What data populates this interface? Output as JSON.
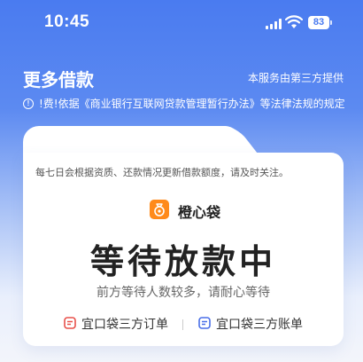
{
  "status_bar": {
    "time": "10:45",
    "battery": "83"
  },
  "header": {
    "title": "更多借款",
    "provider_note": "本服务由第三方提供",
    "notice": "!费!依据《商业银行互联网贷款管理暂行办法》等法律法规的规定"
  },
  "card": {
    "refresh_note": "每七日会根据资质、还款情况更新借款额度，请及时关注。",
    "brand_name": "橙心袋",
    "status_title": "等待放款中",
    "status_subtitle": "前方等待人数较多，请耐心等待",
    "links": {
      "order": "宜口袋三方订单",
      "bill": "宜口袋三方账单"
    }
  },
  "colors": {
    "accent_blue": "#4a7bf0",
    "brand_orange": "#ff8a1a",
    "order_red": "#e8504a",
    "bill_blue": "#4a6fe8"
  },
  "icons": [
    "signal-icon",
    "wifi-icon",
    "battery-icon",
    "info-icon",
    "brand-logo-icon",
    "order-icon",
    "bill-icon"
  ]
}
